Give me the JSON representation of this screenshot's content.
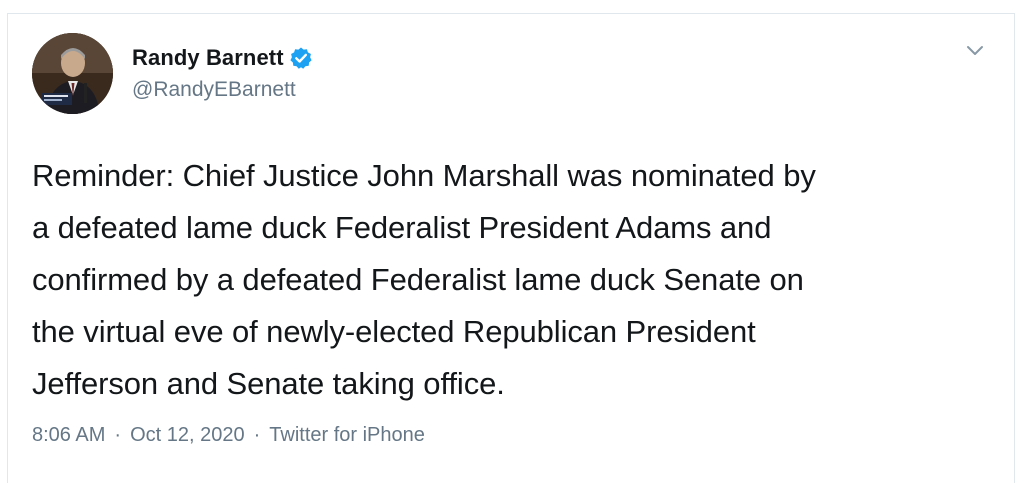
{
  "tweet": {
    "author": {
      "display_name": "Randy Barnett",
      "handle": "@RandyEBarnett",
      "verified": true,
      "avatar_icon": "profile-photo"
    },
    "text": "Reminder: Chief Justice John Marshall was nominated by\na defeated lame duck Federalist President Adams and\nconfirmed by a defeated Federalist lame duck Senate on\nthe virtual eve of newly-elected Republican President\nJefferson and Senate taking office.",
    "time": "8:06 AM",
    "separator": "·",
    "date": "Oct 12, 2020",
    "source": "Twitter for iPhone",
    "menu_icon": "chevron-down-icon"
  },
  "colors": {
    "text": "#14171a",
    "secondary": "#657786",
    "verified": "#1da1f2",
    "border": "#e1e8ed"
  }
}
